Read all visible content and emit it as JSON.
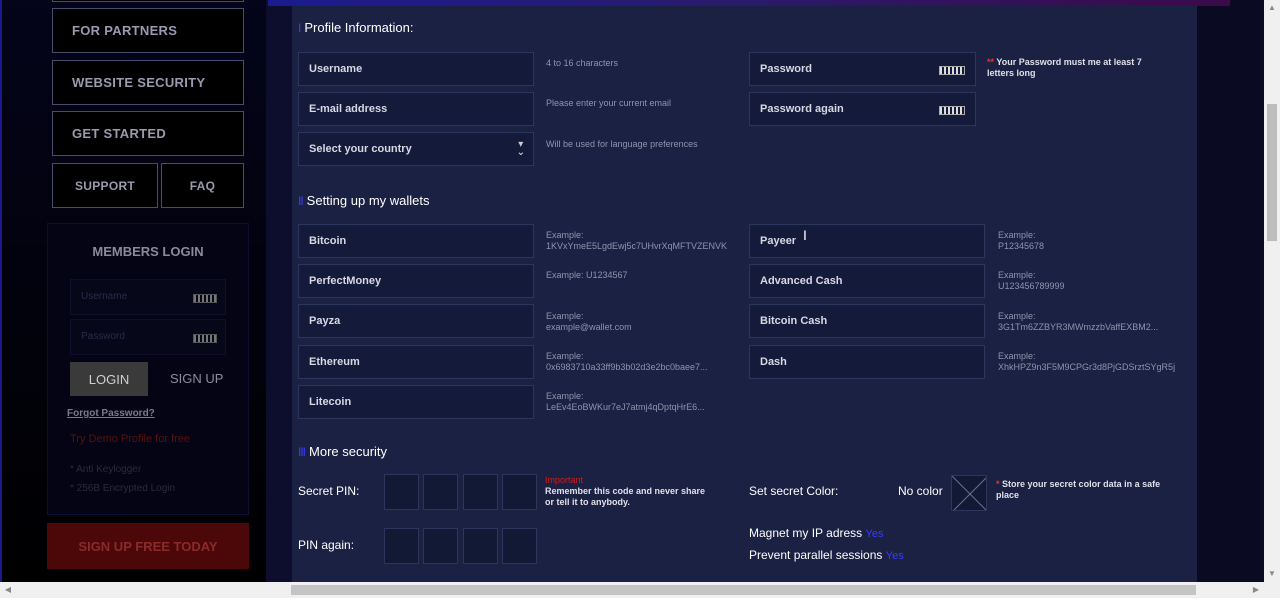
{
  "nav": {
    "for_partners": "FOR PARTNERS",
    "website_security": "WEBSITE SECURITY",
    "get_started": "GET STARTED",
    "support": "SUPPORT",
    "faq": "FAQ"
  },
  "login": {
    "title": "MEMBERS LOGIN",
    "username_placeholder": "Username",
    "password_placeholder": "Password",
    "login_button": "LOGIN",
    "signup": "SIGN UP",
    "forgot": "Forgot Password?",
    "demo": "Try Demo Profile for free",
    "feature1": "* Anti Keylogger",
    "feature2": "* 256B Encrypted Login",
    "signup_free": "SIGN UP FREE TODAY"
  },
  "profile": {
    "section_title": "Profile Information:",
    "section_bars": "I",
    "username_label": "Username",
    "username_hint": "4 to 16 characters",
    "email_label": "E-mail address",
    "email_hint": "Please enter your current email",
    "country_label": "Select your country",
    "country_hint": "Will be used for language preferences",
    "password_label": "Password",
    "password_again_label": "Password again",
    "password_note_star": "**",
    "password_note": "Your Password must me at least 7 letters long"
  },
  "wallets": {
    "section_title": "Setting up my wallets",
    "section_bars": "II",
    "left": [
      {
        "label": "Bitcoin",
        "hint1": "Example:",
        "hint2": "1KVxYmeE5LgdEwj5c7UHvrXqMFTVZENVK"
      },
      {
        "label": "PerfectMoney",
        "hint1": "Example: U1234567",
        "hint2": ""
      },
      {
        "label": "Payza",
        "hint1": "Example:",
        "hint2": "example@wallet.com"
      },
      {
        "label": "Ethereum",
        "hint1": "Example:",
        "hint2": "0x6983710a33ff9b3b02d3e2bc0baee7..."
      },
      {
        "label": "Litecoin",
        "hint1": "Example:",
        "hint2": "LeEv4EoBWKur7eJ7atmj4qDptqHrE6..."
      }
    ],
    "right": [
      {
        "label": "Payeer",
        "hint1": "Example:",
        "hint2": "P12345678"
      },
      {
        "label": "Advanced Cash",
        "hint1": "Example:",
        "hint2": "U123456789999"
      },
      {
        "label": "Bitcoin Cash",
        "hint1": "Example:",
        "hint2": "3G1Tm6ZZBYR3MWmzzbVaffEXBM2..."
      },
      {
        "label": "Dash",
        "hint1": "Example:",
        "hint2": "XhkHPZ9n3F5M9CPGr3d8PjGDSrztSYgR5j"
      }
    ]
  },
  "security": {
    "section_title": "More security",
    "section_bars": "III",
    "secret_pin_label": "Secret PIN:",
    "pin_again_label": "PIN again:",
    "important": "Important",
    "pin_note": "Remember this code and never share or tell it to anybody.",
    "secret_color_label": "Set secret Color:",
    "no_color": "No color",
    "color_note_star": "*",
    "color_note": "Store your secret color data in a safe place",
    "magnet_ip_label": "Magnet my IP adress",
    "magnet_ip_value": "Yes",
    "parallel_label": "Prevent parallel sessions",
    "parallel_value": "Yes"
  }
}
